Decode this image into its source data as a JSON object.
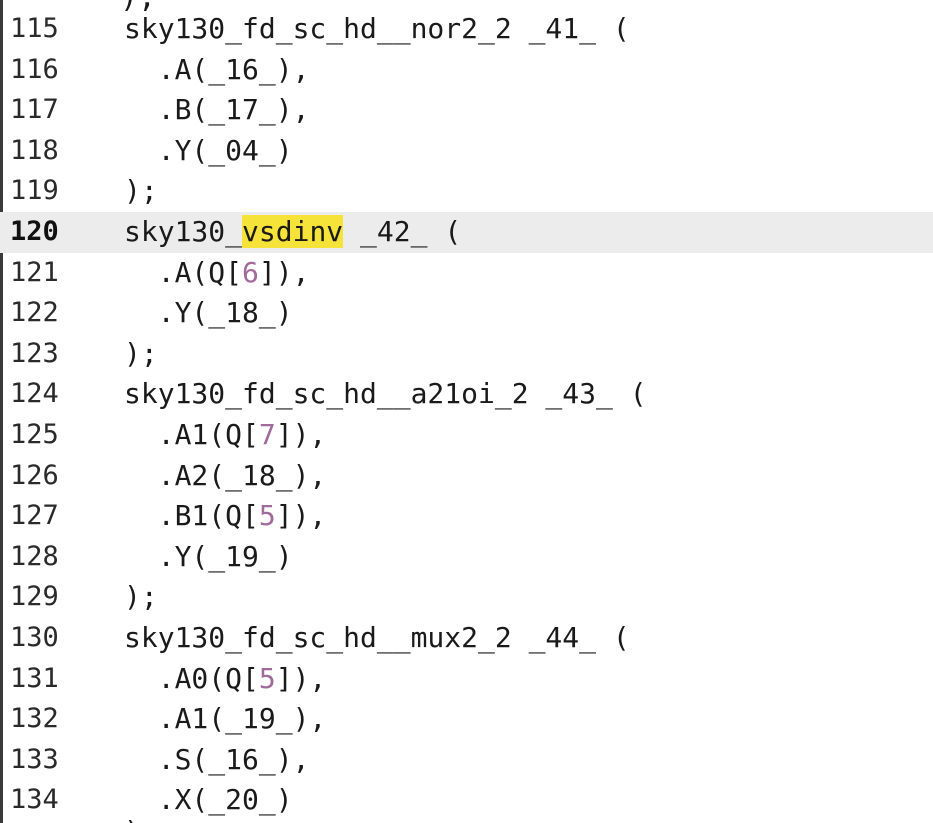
{
  "editor": {
    "top_partial_text": ");",
    "bottom_partial_text": ");",
    "current_line": "120",
    "colors": {
      "background": "#ffffff",
      "current_line_background": "#ececec",
      "search_highlight": "#f6e33a",
      "number_literal": "#a06a9a",
      "text": "#1a1a1a"
    },
    "lines": [
      {
        "no": "115",
        "text": "sky130_fd_sc_hd__nor2_2 _41_ ("
      },
      {
        "no": "116",
        "text": "  .A(_16_),"
      },
      {
        "no": "117",
        "text": "  .B(_17_),"
      },
      {
        "no": "118",
        "text": "  .Y(_04_)"
      },
      {
        "no": "119",
        "text": ");"
      },
      {
        "no": "120",
        "pre": "sky130_",
        "highlight": "vsdinv",
        "post": " _42_ ("
      },
      {
        "no": "121",
        "pre": "  .A(Q[",
        "num": "6",
        "post": "]),"
      },
      {
        "no": "122",
        "text": "  .Y(_18_)"
      },
      {
        "no": "123",
        "text": ");"
      },
      {
        "no": "124",
        "text": "sky130_fd_sc_hd__a21oi_2 _43_ ("
      },
      {
        "no": "125",
        "pre": "  .A1(Q[",
        "num": "7",
        "post": "]),"
      },
      {
        "no": "126",
        "text": "  .A2(_18_),"
      },
      {
        "no": "127",
        "pre": "  .B1(Q[",
        "num": "5",
        "post": "]),"
      },
      {
        "no": "128",
        "text": "  .Y(_19_)"
      },
      {
        "no": "129",
        "text": ");"
      },
      {
        "no": "130",
        "text": "sky130_fd_sc_hd__mux2_2 _44_ ("
      },
      {
        "no": "131",
        "pre": "  .A0(Q[",
        "num": "5",
        "post": "]),"
      },
      {
        "no": "132",
        "text": "  .A1(_19_),"
      },
      {
        "no": "133",
        "text": "  .S(_16_),"
      },
      {
        "no": "134",
        "text": "  .X(_20_)"
      }
    ]
  }
}
